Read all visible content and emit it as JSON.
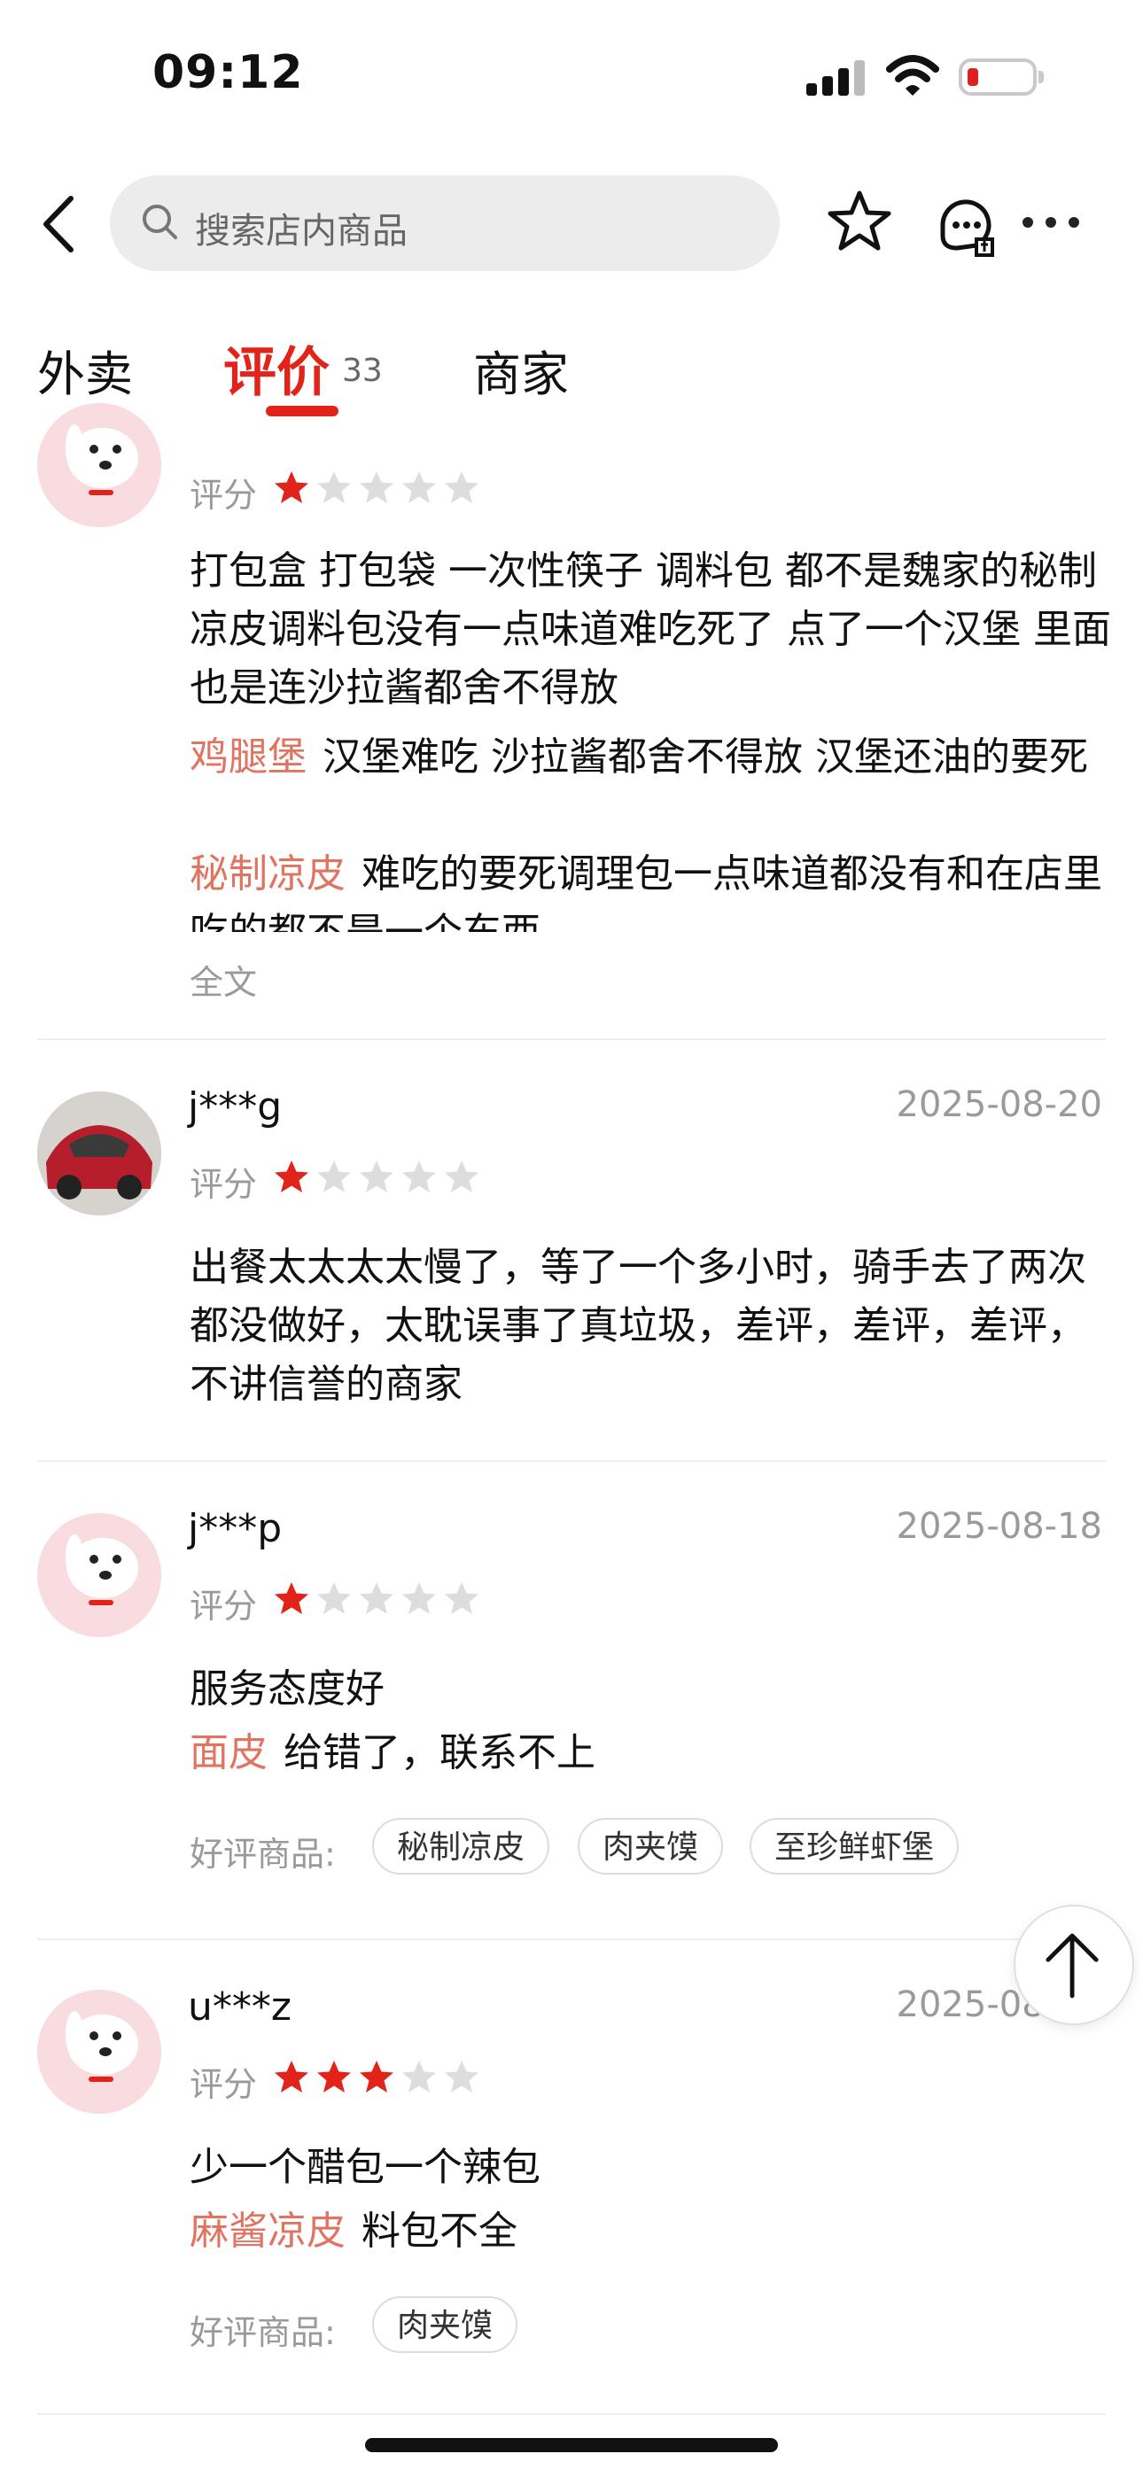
{
  "status_bar": {
    "time": "09:12"
  },
  "header": {
    "search_placeholder": "搜索店内商品"
  },
  "tabs": {
    "delivery": "外卖",
    "review": "评价",
    "review_count": "33",
    "merchant": "商家"
  },
  "colors": {
    "accent": "#e2231a",
    "dish": "#e07461",
    "muted": "#9a9a9a"
  },
  "reviews": [
    {
      "score_label": "评分",
      "rating": 1,
      "text": "打包盒 打包袋 一次性筷子 调料包 都不是魏家的秘制凉皮调料包没有一点味道难吃死了 点了一个汉堡 里面也是连沙拉酱都舍不得放",
      "dish_comments": [
        {
          "dish": "鸡腿堡",
          "text": "汉堡难吃 沙拉酱都舍不得放 汉堡还油的要死"
        },
        {
          "dish": "秘制凉皮",
          "text": "难吃的要死调理包一点味道都没有和在店里吃的都不是一个东西"
        }
      ],
      "fulltext": "全文"
    },
    {
      "user": "j***g",
      "date": "2025-08-20",
      "score_label": "评分",
      "rating": 1,
      "text": "出餐太太太太慢了，等了一个多小时，骑手去了两次都没做好，太耽误事了真垃圾，差评，差评，差评，不讲信誉的商家"
    },
    {
      "user": "j***p",
      "date": "2025-08-18",
      "score_label": "评分",
      "rating": 1,
      "text": "服务态度好",
      "dish_comments": [
        {
          "dish": "面皮",
          "text": "给错了，联系不上"
        }
      ],
      "good_label": "好评商品:",
      "good_items": [
        "秘制凉皮",
        "肉夹馍",
        "至珍鲜虾堡"
      ]
    },
    {
      "user": "u***z",
      "date": "2025-08-17",
      "score_label": "评分",
      "rating": 3,
      "text": "少一个醋包一个辣包",
      "dish_comments": [
        {
          "dish": "麻酱凉皮",
          "text": "料包不全"
        }
      ],
      "good_label": "好评商品:",
      "good_items": [
        "肉夹馍"
      ]
    }
  ]
}
